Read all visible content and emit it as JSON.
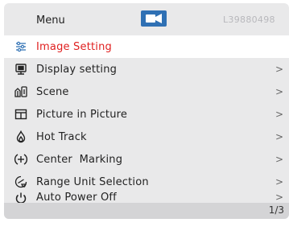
{
  "header": {
    "title": "Menu",
    "serial": "L39880498",
    "icon": "video-camera-icon",
    "accent": "#2f70b4"
  },
  "items": [
    {
      "label": "Image Setting",
      "icon": "sliders-icon",
      "chevron": ""
    },
    {
      "label": "Display setting",
      "icon": "display-icon",
      "chevron": ">"
    },
    {
      "label": "Scene",
      "icon": "scene-icon",
      "chevron": ">"
    },
    {
      "label": "Picture in Picture",
      "icon": "pip-icon",
      "chevron": ">"
    },
    {
      "label": "Hot Track",
      "icon": "flame-icon",
      "chevron": ">"
    },
    {
      "label": "Center  Marking",
      "icon": "crosshair-icon",
      "chevron": ">"
    },
    {
      "label": "Range Unit Selection",
      "icon": "range-unit-icon",
      "chevron": ">"
    },
    {
      "label": "Auto Power Off",
      "icon": "power-icon",
      "chevron": ">"
    }
  ],
  "selected_index": 0,
  "footer": {
    "page": "1/3"
  },
  "colors": {
    "selected_text": "#e02020",
    "panel": "#e9e9ea",
    "footer": "#d4d4d6"
  }
}
